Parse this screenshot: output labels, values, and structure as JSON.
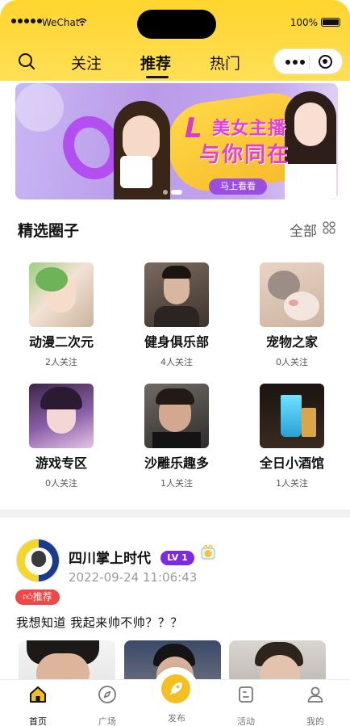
{
  "status_bar": {
    "carrier": "WeChat",
    "battery_text": "100%"
  },
  "nav": {
    "tabs": [
      {
        "label": "关注"
      },
      {
        "label": "推荐",
        "active": true
      },
      {
        "label": "热门"
      }
    ]
  },
  "banner": {
    "logo_text": "L",
    "title_line1": "美女主播",
    "title_line2": "与你同在",
    "cta": "马上看看"
  },
  "featured": {
    "title": "精选圈子",
    "all_label": "全部",
    "circles": [
      {
        "name": "动漫二次元",
        "followers": "2人关注"
      },
      {
        "name": "健身俱乐部",
        "followers": "4人关注"
      },
      {
        "name": "宠物之家",
        "followers": "0人关注"
      },
      {
        "name": "游戏专区",
        "followers": "0人关注"
      },
      {
        "name": "沙雕乐趣多",
        "followers": "1人关注"
      },
      {
        "name": "全日小酒馆",
        "followers": "1人关注"
      }
    ]
  },
  "post": {
    "author": "四川掌上时代",
    "level": "LV 1",
    "time": "2022-09-24 11:06:43",
    "tag": "推荐",
    "text": "我想知道 我起来帅不帅？？？"
  },
  "tabbar": {
    "items": [
      {
        "label": "首页",
        "icon": "home-icon",
        "active": true
      },
      {
        "label": "广场",
        "icon": "compass-icon"
      },
      {
        "label": "发布",
        "icon": "rocket-icon"
      },
      {
        "label": "活动",
        "icon": "activity-icon"
      },
      {
        "label": "我的",
        "icon": "user-icon"
      }
    ]
  },
  "colors": {
    "header_yellow": "#ffd52e",
    "level_purple": "#7b2be2",
    "tag_red": "#f04848",
    "publish_yellow": "#f5bf22"
  }
}
